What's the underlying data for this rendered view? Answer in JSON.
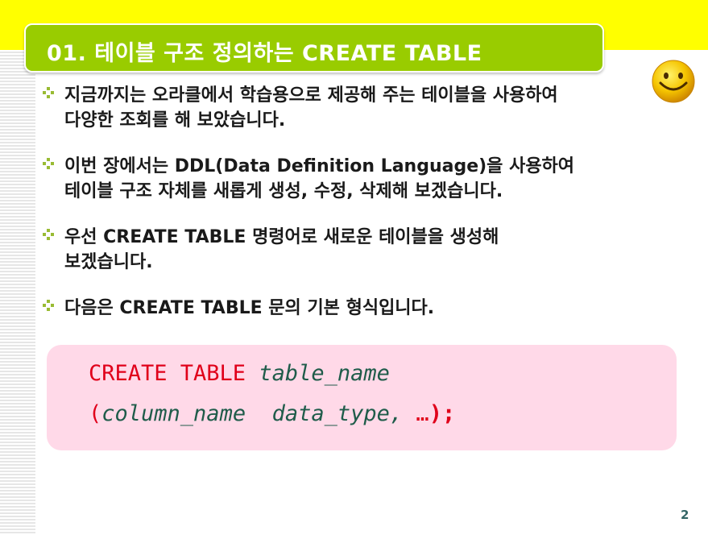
{
  "slide": {
    "title": "01. 테이블 구조 정의하는 CREATE TABLE",
    "bullets": [
      {
        "lines": [
          "지금까지는 오라클에서 학습용으로 제공해 주는 테이블을 사용하여",
          "다양한 조회를 해 보았습니다."
        ]
      },
      {
        "lines": [
          "이번 장에서는 DDL(Data Definition Language)을 사용하여",
          "테이블 구조 자체를 새롭게 생성, 수정, 삭제해 보겠습니다."
        ]
      },
      {
        "lines": [
          "우선 CREATE TABLE 명령어로 새로운 테이블을 생성해",
          "보겠습니다."
        ]
      },
      {
        "lines": [
          "다음은 CREATE TABLE 문의 기본 형식입니다."
        ]
      }
    ],
    "code": {
      "line1_keyword": "CREATE TABLE",
      "line1_name": "table_name",
      "line2_open": "(",
      "line2_column": "column_name",
      "line2_type": "data_type,",
      "line2_ellipsis": "…",
      "line2_close": ");"
    },
    "page_number": "2",
    "colors": {
      "top_band": "#ffff00",
      "title_box": "#99cc00",
      "code_box": "#ffd9e8",
      "keyword": "#e0001a",
      "identifier": "#1f5c4a"
    },
    "icons": {
      "bullet": "diamond-bullet-icon",
      "decoration": "smiley-icon"
    }
  }
}
